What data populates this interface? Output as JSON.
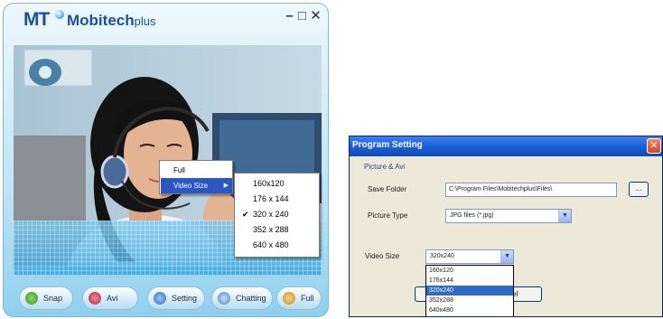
{
  "app": {
    "brand_mt": "MT",
    "brand_name": "Mobitech",
    "brand_plus": "plus",
    "window_controls": {
      "minimize": "–",
      "maximize": "□",
      "close": "✕"
    },
    "context_menu": {
      "items": [
        "Full",
        "Video Size"
      ],
      "submenu_arrow": "▶"
    },
    "size_menu": {
      "items": [
        "160x120",
        "176 x 144",
        "320 x 240",
        "352 x 288",
        "640 x 480"
      ],
      "checked": "320 x 240",
      "check_glyph": "✔"
    },
    "toolbar": {
      "snap": "Snap",
      "avi": "Avi",
      "setting": "Setting",
      "chatting": "Chatting",
      "full": "Full"
    },
    "colors": {
      "accent": "#2b56c4",
      "frame": "#8fd0ef"
    }
  },
  "dialog": {
    "title": "Program Setting",
    "close_glyph": "✕",
    "group_label": "Picture & Avi",
    "save_folder_label": "Save Folder",
    "save_folder_value": "C:\\Program Files\\Mobitechplus\\Files\\",
    "browse_label": "...",
    "picture_type_label": "Picture Type",
    "picture_type_value": "JPG files (*.jpg)",
    "video_size_label": "Video Size",
    "video_size_value": "320x240",
    "video_size_options": [
      "160x120",
      "176x144",
      "320x240",
      "352x288",
      "640x480"
    ],
    "video_size_selected_index": 2,
    "cancel_label": "el",
    "dropdown_glyph": "▼"
  }
}
